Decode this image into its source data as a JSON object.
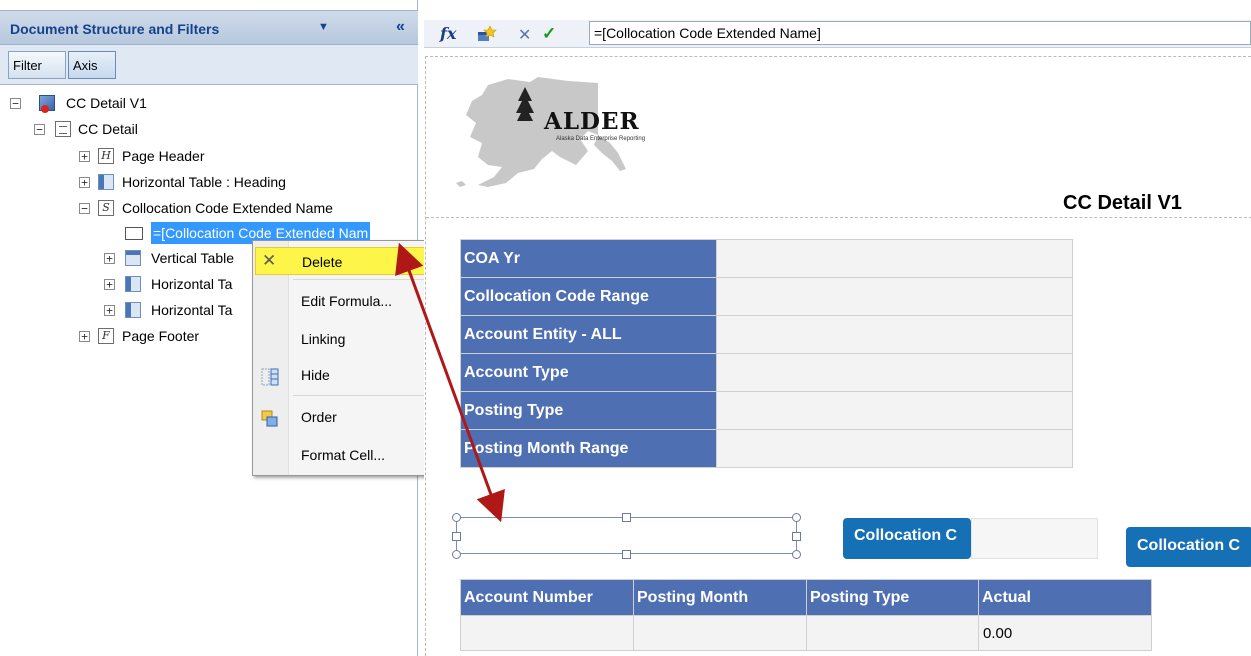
{
  "panel": {
    "title": "Document Structure and Filters",
    "caret": "▼",
    "collapse": "«",
    "tabs": [
      "Filter",
      "Axis"
    ]
  },
  "tree": {
    "root": "CC Detail V1",
    "report": "CC Detail",
    "page_header": "Page Header",
    "heading_table": "Horizontal Table : Heading",
    "section": "Collocation Code Extended Name",
    "selected_cell": "=[Collocation Code Extended Nam",
    "vertical_table": "Vertical Table",
    "horizontal_table_a": "Horizontal Ta",
    "horizontal_table_b": "Horizontal Ta",
    "page_footer": "Page Footer",
    "expanded_glyph": "−",
    "collapsed_glyph": "+",
    "icon_letters": {
      "header": "H",
      "section": "S",
      "footer": "F"
    }
  },
  "context_menu": {
    "items": [
      "Delete",
      "Edit Formula...",
      "Linking",
      "Hide",
      "Order",
      "Format Cell..."
    ],
    "submenu_glyph": "▶",
    "delete_icon_glyph": "✕"
  },
  "formula_bar": {
    "fx": "fx",
    "cancel": "✕",
    "accept": "✓",
    "value": "=[Collocation Code Extended Name]"
  },
  "report": {
    "logo_text": "ALDER",
    "logo_subtext": "Alaska Data Enterprise Reporting",
    "title": "CC Detail V1",
    "params": [
      "COA Yr",
      "Collocation Code Range",
      "Account Entity - ALL",
      "Account Type",
      "Posting Type",
      "Posting Month Range"
    ],
    "pill_1": "Collocation C",
    "pill_2": "Collocation C",
    "table_headers": [
      "Account Number",
      "Posting Month",
      "Posting Type",
      "Actual"
    ],
    "table_row": [
      "",
      "",
      "",
      "0.00"
    ]
  },
  "colors": {
    "header_blue": "#4f6fb3",
    "pill_blue": "#1670b5",
    "highlight_yellow": "#fdf548",
    "selection_blue": "#3399ff",
    "arrow_red": "#b01818"
  }
}
